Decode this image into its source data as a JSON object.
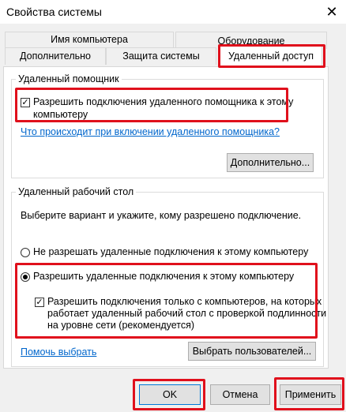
{
  "window": {
    "title": "Свойства системы",
    "close_glyph": "✕"
  },
  "tabs": {
    "row1": [
      "Имя компьютера",
      "Оборудование"
    ],
    "row2": [
      "Дополнительно",
      "Защита системы",
      "Удаленный доступ"
    ],
    "active": "Удаленный доступ"
  },
  "remote_assistance": {
    "legend": "Удаленный помощник",
    "allow_label_line1": "Разрешить подключения удаленного помощника к этому",
    "allow_label_line2": "компьютеру",
    "allow_checked": true,
    "help_link": "Что происходит при включении удаленного помощника?",
    "advanced_button": "Дополнительно..."
  },
  "remote_desktop": {
    "legend": "Удаленный рабочий стол",
    "instruction": "Выберите вариант и укажите, кому разрешено подключение.",
    "option_deny": "Не разрешать удаленные подключения к этому компьютеру",
    "option_allow": "Разрешить удаленные подключения к этому компьютеру",
    "selected": "allow",
    "nla_line1": "Разрешить подключения только с компьютеров, на которых",
    "nla_line2": "работает удаленный рабочий стол с проверкой подлинности",
    "nla_line3": "на уровне сети (рекомендуется)",
    "nla_checked": true,
    "help_link": "Помочь выбрать",
    "select_users_button": "Выбрать пользователей..."
  },
  "footer": {
    "ok": "OK",
    "cancel": "Отмена",
    "apply": "Применить"
  },
  "colors": {
    "highlight": "#e0101c",
    "link": "#0066cc"
  }
}
